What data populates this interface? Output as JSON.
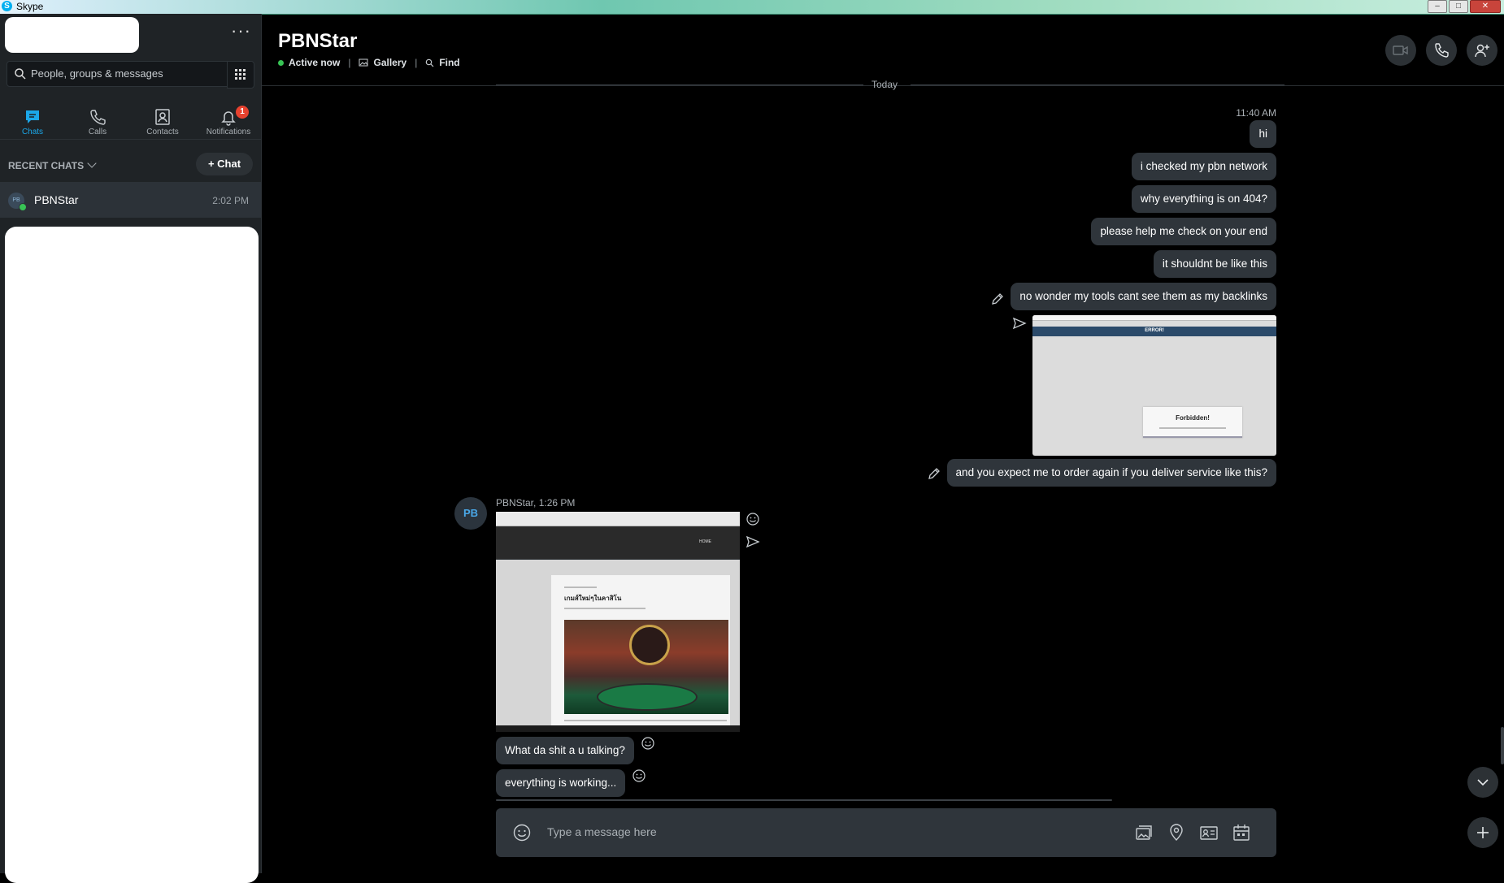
{
  "window": {
    "title": "Skype"
  },
  "sidebar": {
    "search_placeholder": "People, groups & messages",
    "nav": [
      {
        "label": "Chats",
        "icon": "chat-icon",
        "active": true
      },
      {
        "label": "Calls",
        "icon": "phone-icon"
      },
      {
        "label": "Contacts",
        "icon": "contacts-icon"
      },
      {
        "label": "Notifications",
        "icon": "bell-icon",
        "badge": "1"
      }
    ],
    "recent_label": "RECENT CHATS",
    "new_chat_label": "Chat",
    "chats": [
      {
        "avatar_initials": "PB",
        "name": "PBNStar",
        "time": "2:02 PM",
        "online": true
      }
    ]
  },
  "conversation": {
    "contact_name": "PBNStar",
    "status": "Active now",
    "gallery_label": "Gallery",
    "find_label": "Find",
    "day_divider": "Today",
    "first_time": "11:40 AM",
    "outgoing": [
      "hi",
      "i checked my pbn network",
      "why everything is on 404?",
      "please help me check on your end",
      "it shouldnt be like this",
      "no wonder my tools cant see them as my backlinks",
      "and you expect me to order again if you deliver service like this?"
    ],
    "outgoing_image": {
      "banner_text": "ERROR!",
      "box_title": "Forbidden!"
    },
    "incoming_sender": "PBNStar, 1:26 PM",
    "incoming_avatar": "PB",
    "incoming_image": {
      "nav_link": "HOME",
      "post_title": "เกมส์ใหม่ๆในคาสิโน"
    },
    "incoming": [
      "What da shit a u talking?",
      "everything is working..."
    ],
    "composer_placeholder": "Type a message here"
  },
  "colors": {
    "background": "#000000",
    "sidebar_bg": "#1f2326",
    "bubble": "#2f353b",
    "accent": "#1ba7e8",
    "online": "#38c455",
    "badge": "#e8422f"
  }
}
